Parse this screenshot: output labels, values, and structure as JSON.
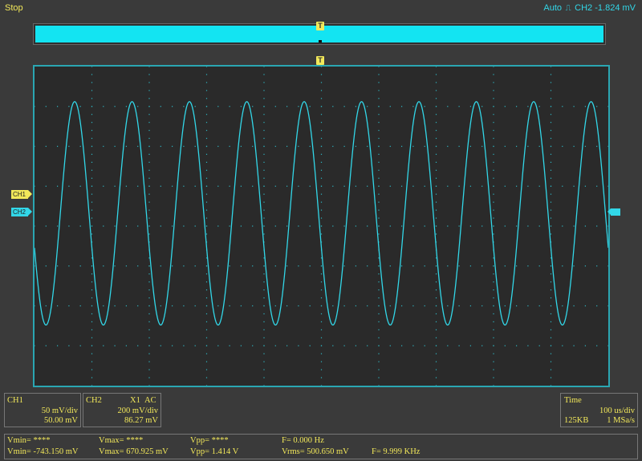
{
  "status": {
    "run_state": "Stop",
    "trigger_mode": "Auto",
    "trigger_icon": "trigger-edge-icon",
    "trigger_source": "CH2",
    "trigger_level": "-1.824 mV"
  },
  "markers": {
    "trigger_top": "T",
    "trigger_grid": "T"
  },
  "channels": {
    "ch1_label": "CH1",
    "ch2_label": "CH2"
  },
  "colors": {
    "ch1": "#f2e85a",
    "ch2": "#32d7e8",
    "grid_dots": "#2fb7c4",
    "background": "#3a3a3a"
  },
  "ch1_panel": {
    "name": "CH1",
    "scale": "50 mV/div",
    "offset": "50.00 mV"
  },
  "ch2_panel": {
    "name": "CH2",
    "probe": "X1",
    "coupling": "AC",
    "scale": "200 mV/div",
    "offset": "86.27 mV"
  },
  "time_panel": {
    "title": "Time",
    "scale": "100 us/div",
    "memory": "125KB",
    "rate": "1 MSa/s"
  },
  "measurements": {
    "vmin_ch1": "Vmin= ****",
    "vmax_ch1": "Vmax= ****",
    "vpp_ch1": "Vpp= ****",
    "freq_ch1": "F= 0.000 Hz",
    "vmin_ch2": "Vmin= -743.150 mV",
    "vmax_ch2": "Vmax= 670.925 mV",
    "vpp_ch2": "Vpp= 1.414 V",
    "vrms_ch2": "Vrms= 500.650 mV",
    "freq_ch2": "F= 9.999 KHz"
  },
  "waveform": {
    "channel": "CH2",
    "type": "sine",
    "frequency_hz": 9999,
    "vmin_mv": -743.15,
    "vmax_mv": 670.925,
    "cycles_visible": 10
  }
}
